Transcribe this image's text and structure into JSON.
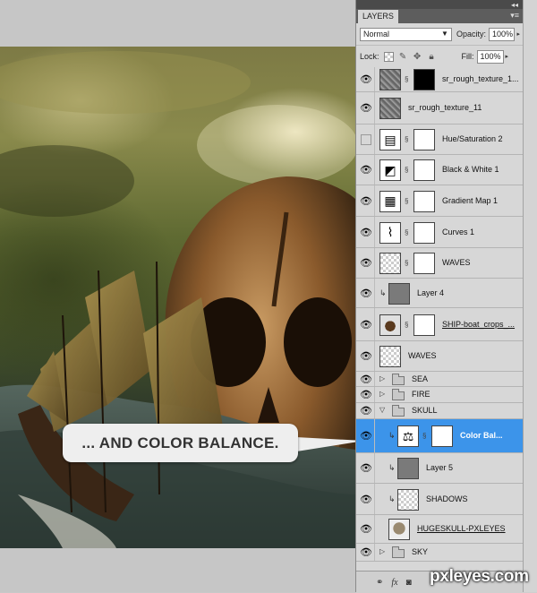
{
  "callout": {
    "text": "... AND COLOR BALANCE."
  },
  "panel": {
    "tab_label": "LAYERS",
    "collapse_glyph": "◂◂",
    "menu_glyph": "▾≡",
    "blend_mode": "Normal",
    "opacity_label": "Opacity:",
    "opacity_value": "100%",
    "lock_label": "Lock:",
    "fill_label": "Fill:",
    "fill_value": "100%"
  },
  "layers": [
    {
      "name": "sr_rough_texture_1...",
      "visible": true,
      "thumb": "texture",
      "mask": "black"
    },
    {
      "name": "sr_rough_texture_11",
      "visible": true,
      "thumb": "texture"
    },
    {
      "name": "Hue/Saturation 2",
      "visible": false,
      "thumb": "hue-sat-adjustment-icon",
      "mask": "white"
    },
    {
      "name": "Black & White 1",
      "visible": true,
      "thumb": "black-white-adjustment-icon",
      "mask": "white"
    },
    {
      "name": "Gradient Map 1",
      "visible": true,
      "thumb": "gradient-map-adjustment-icon",
      "mask": "white"
    },
    {
      "name": "Curves 1",
      "visible": true,
      "thumb": "curves-adjustment-icon",
      "mask": "white"
    },
    {
      "name": "WAVES",
      "visible": true,
      "thumb": "checker",
      "mask": "white"
    },
    {
      "name": "Layer 4",
      "visible": true,
      "thumb": "gray",
      "clipped": true
    },
    {
      "name": "SHIP-boat_crops_...",
      "visible": true,
      "thumb": "ship",
      "mask": "white"
    },
    {
      "name": "WAVES",
      "visible": true,
      "thumb": "checker"
    },
    {
      "name": "SEA",
      "visible": true,
      "group": true,
      "expanded": false
    },
    {
      "name": "FIRE",
      "visible": true,
      "group": true,
      "expanded": false
    },
    {
      "name": "SKULL",
      "visible": true,
      "group": true,
      "expanded": true
    },
    {
      "name": "Color Bal...",
      "visible": true,
      "thumb": "color-balance-adjustment-icon",
      "mask": "white",
      "selected": true,
      "clipped": true
    },
    {
      "name": "Layer 5",
      "visible": true,
      "thumb": "gray",
      "clipped": true
    },
    {
      "name": "SHADOWS",
      "visible": true,
      "thumb": "checker",
      "clipped": true
    },
    {
      "name": "HUGESKULL-PXLEYES",
      "visible": true,
      "thumb": "skull"
    },
    {
      "name": "SKY",
      "visible": true,
      "group": true,
      "expanded": false
    }
  ],
  "footer": {
    "link_icon": "link-icon",
    "fx_label": "fx",
    "mask_icon": "add-mask-icon"
  },
  "watermark": {
    "text": "pxleyes.com"
  },
  "colors": {
    "selected_row": "#3c94ea",
    "panel_bg": "#d7d7d7",
    "callout_bg": "#eeeeee"
  }
}
